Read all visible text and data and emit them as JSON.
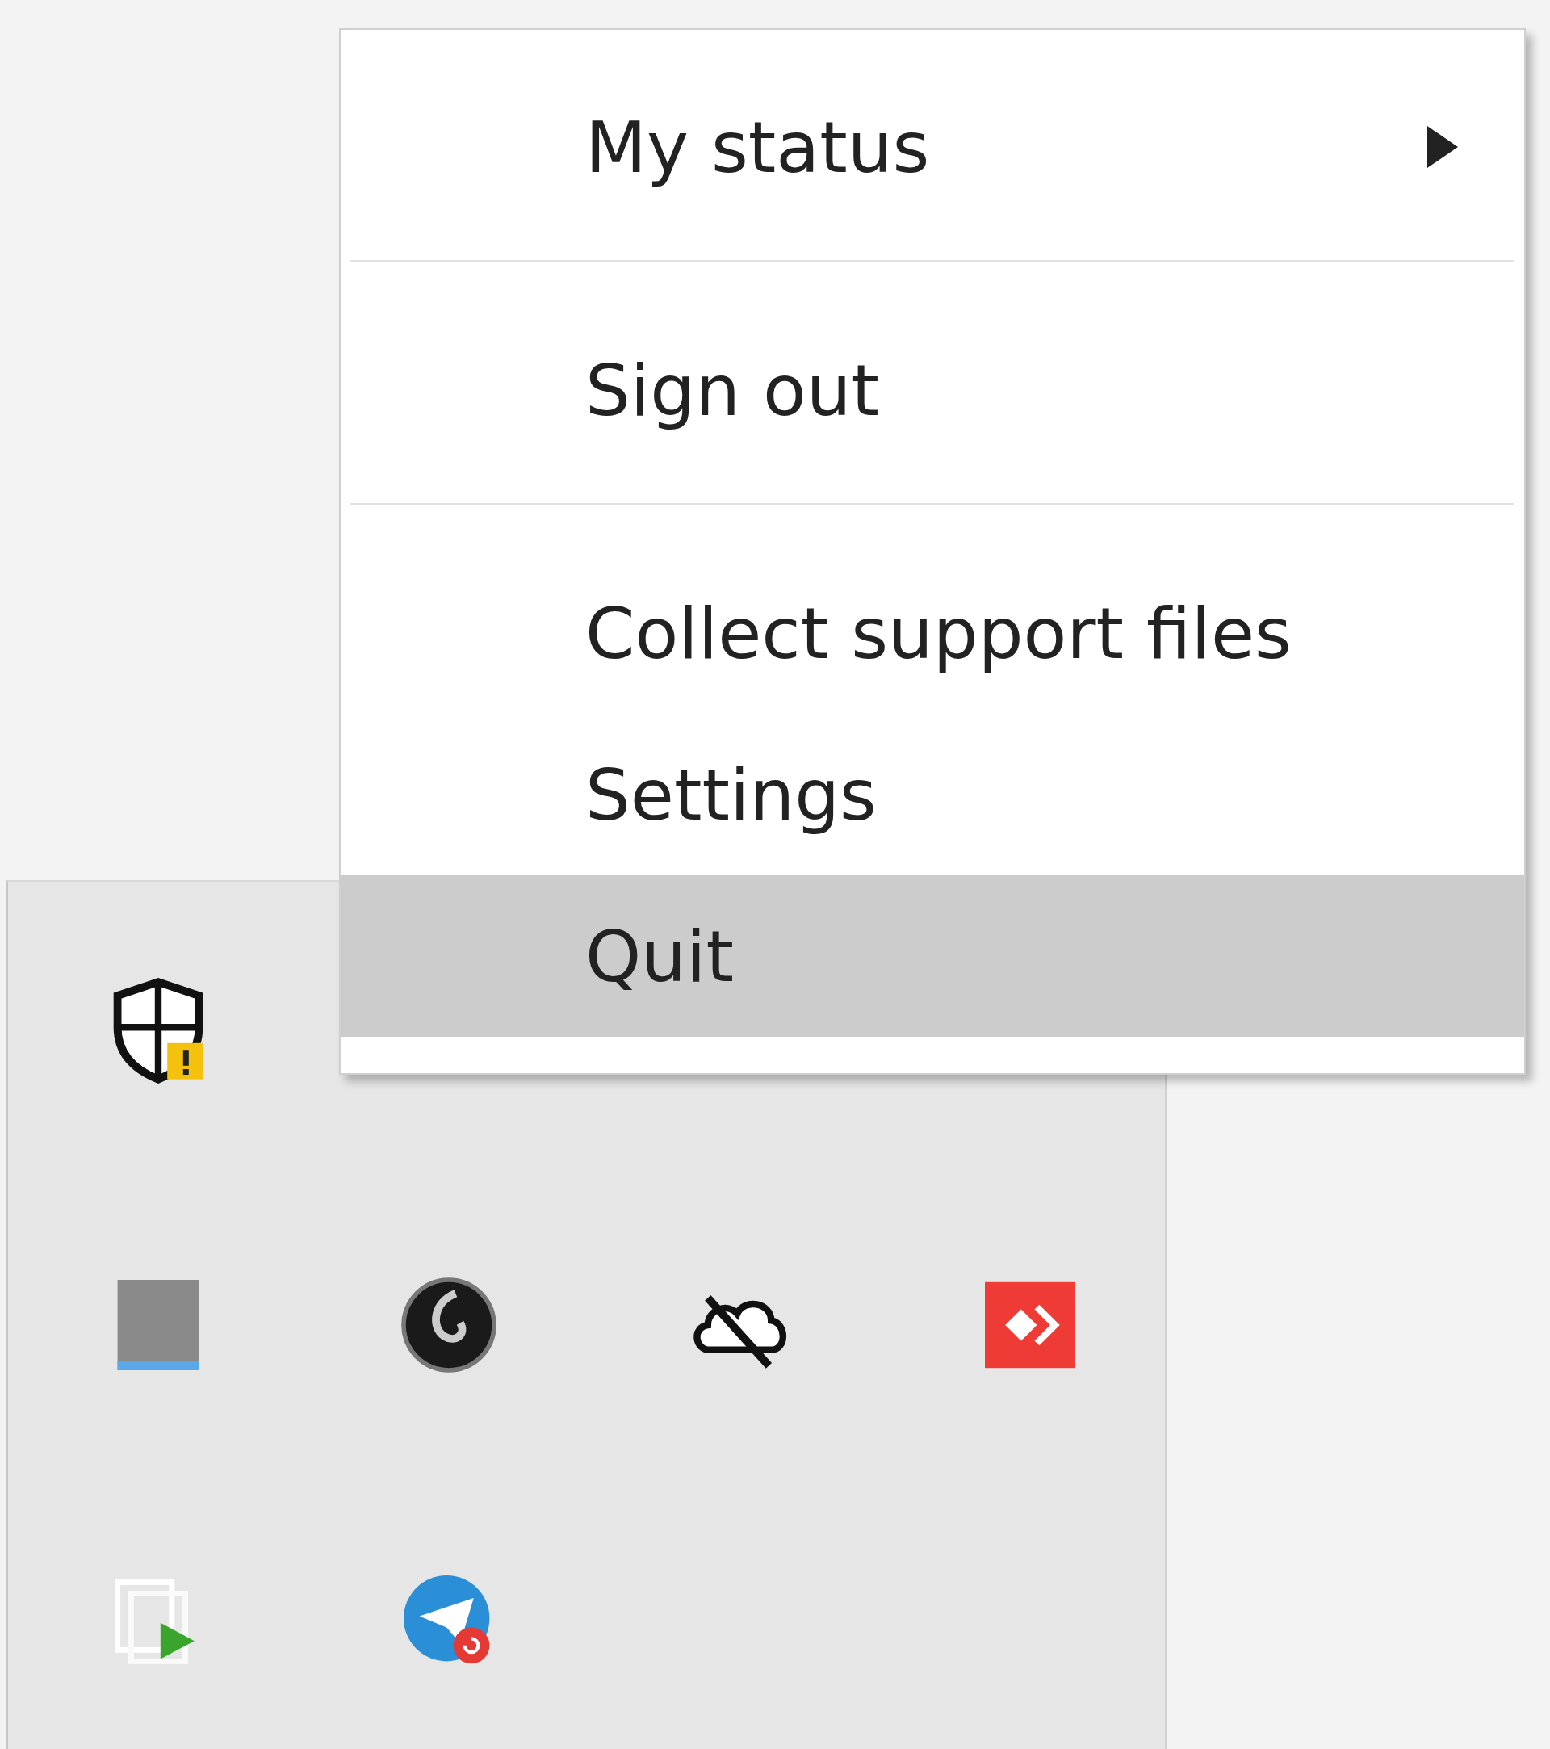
{
  "context_menu": {
    "items": [
      {
        "kind": "item",
        "label": "My status",
        "submenu": true,
        "selected": false
      },
      {
        "kind": "separator"
      },
      {
        "kind": "item",
        "label": "Sign out",
        "submenu": false,
        "selected": false
      },
      {
        "kind": "separator"
      },
      {
        "kind": "item",
        "label": "Collect support files",
        "submenu": false,
        "selected": false
      },
      {
        "kind": "item",
        "label": "Settings",
        "submenu": false,
        "selected": false
      },
      {
        "kind": "item",
        "label": "Quit",
        "submenu": false,
        "selected": true
      }
    ]
  }
}
